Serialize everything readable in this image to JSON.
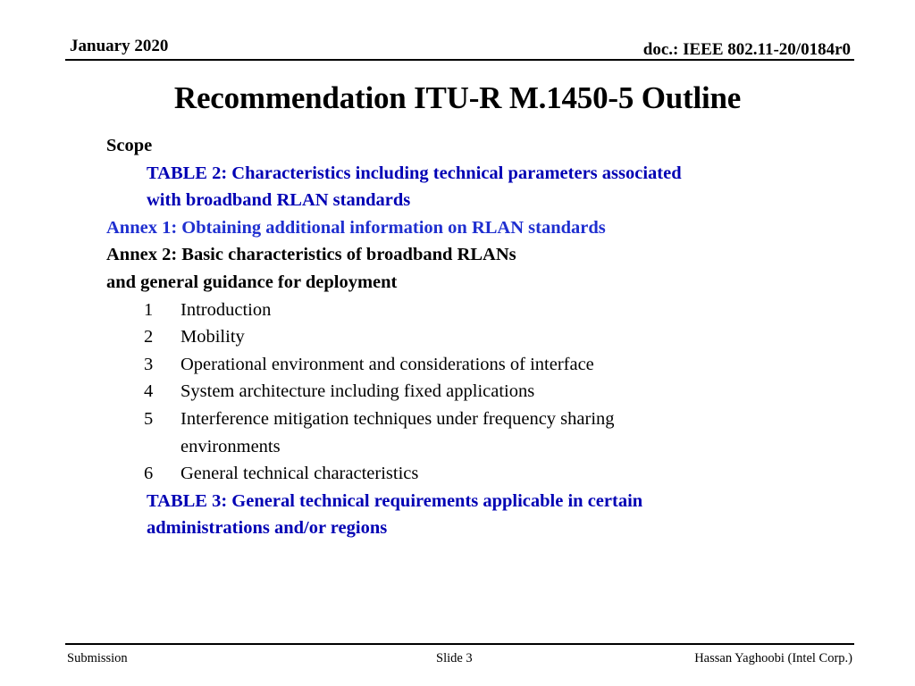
{
  "header": {
    "date": "January 2020",
    "doc_id": "doc.: IEEE 802.11-20/0184r0"
  },
  "title": "Recommendation  ITU-R  M.1450-5 Outline",
  "outline": {
    "scope": "Scope",
    "table2_line1": "TABLE 2: Characteristics including technical parameters associated",
    "table2_line2": "with broadband RLAN standards",
    "annex1": "Annex 1: Obtaining additional information on RLAN standards",
    "annex2_line1": "Annex 2: Basic characteristics of broadband RLANs",
    "annex2_line2": "and general guidance for deployment",
    "sections": [
      {
        "num": "1",
        "text": "Introduction"
      },
      {
        "num": "2",
        "text": "Mobility"
      },
      {
        "num": "3",
        "text": "Operational environment and considerations of interface"
      },
      {
        "num": "4",
        "text": "System architecture including fixed applications"
      },
      {
        "num": "5",
        "text": "Interference mitigation techniques under frequency sharing",
        "cont": "environments"
      },
      {
        "num": "6",
        "text": "General technical characteristics"
      }
    ],
    "table3_line1": "TABLE 3: General technical requirements applicable in certain",
    "table3_line2": "administrations and/or regions"
  },
  "footer": {
    "left": "Submission",
    "center": "Slide 3",
    "right": "Hassan Yaghoobi (Intel Corp.)"
  },
  "colors": {
    "table_link": "#0000b4",
    "annex1_link": "#1f2fd0",
    "text": "#000000"
  }
}
